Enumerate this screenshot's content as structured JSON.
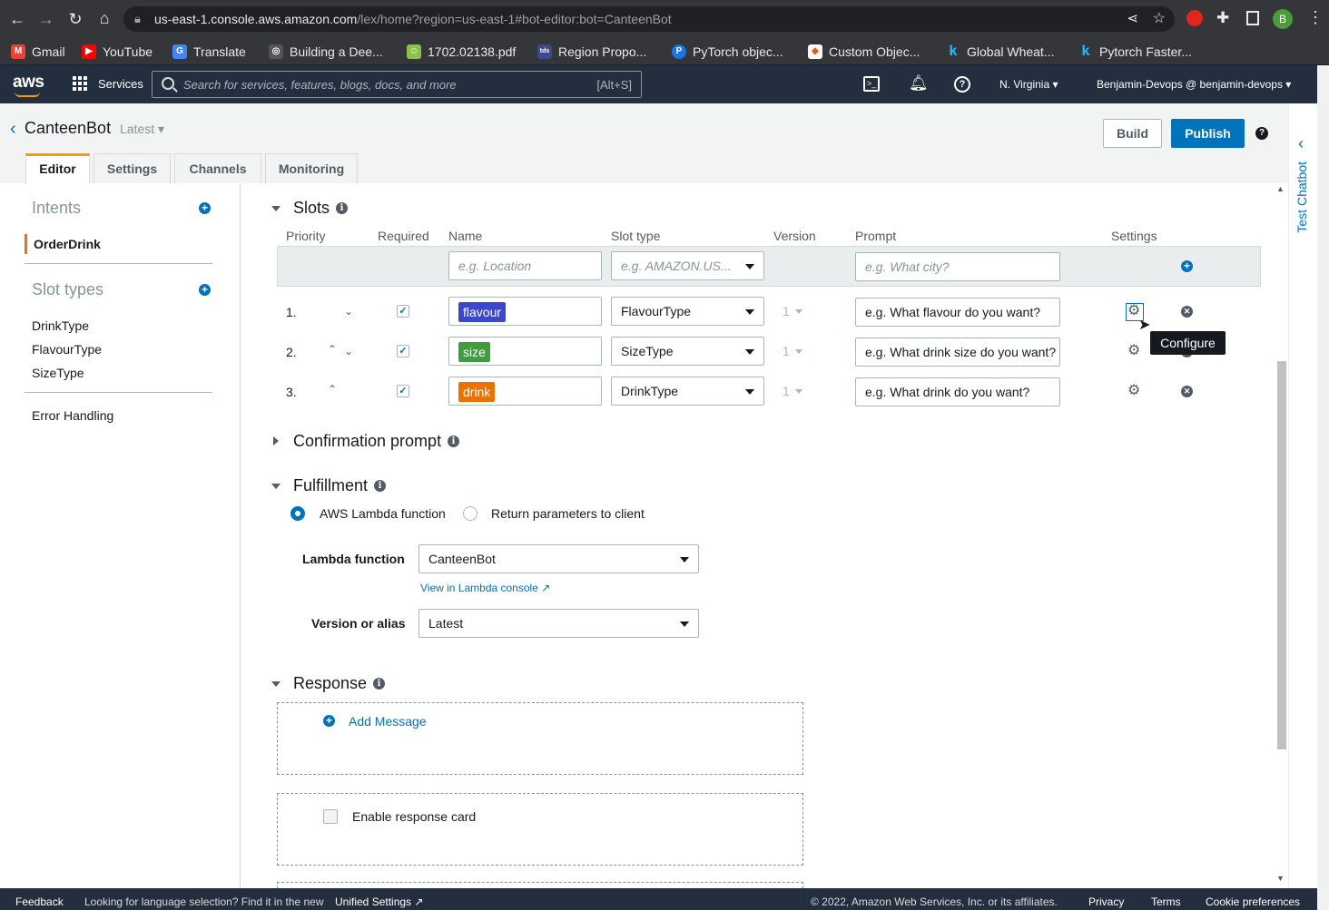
{
  "browser": {
    "url_host": "us-east-1.console.aws.amazon.com",
    "url_path": "/lex/home?region=us-east-1#bot-editor:bot=CanteenBot",
    "profile_initial": "B",
    "bookmarks": [
      "Gmail",
      "YouTube",
      "Translate",
      "Building a Dee...",
      "1702.02138.pdf",
      "Region Propo...",
      "PyTorch objec...",
      "Custom Objec...",
      "Global Wheat...",
      "Pytorch Faster..."
    ]
  },
  "aws_nav": {
    "logo": "aws",
    "services": "Services",
    "search_placeholder": "Search for services, features, blogs, docs, and more",
    "search_shortcut": "[Alt+S]",
    "region": "N. Virginia",
    "account": "Benjamin-Devops @ benjamin-devops"
  },
  "header": {
    "bot_name": "CanteenBot",
    "bot_version": "Latest",
    "build": "Build",
    "publish": "Publish",
    "tabs": [
      "Editor",
      "Settings",
      "Channels",
      "Monitoring"
    ]
  },
  "sidebar": {
    "intents_title": "Intents",
    "intents": [
      "OrderDrink"
    ],
    "slot_types_title": "Slot types",
    "slot_types": [
      "DrinkType",
      "FlavourType",
      "SizeType"
    ],
    "error_handling": "Error Handling"
  },
  "slots": {
    "title": "Slots",
    "columns": [
      "Priority",
      "Required",
      "Name",
      "Slot type",
      "Version",
      "Prompt",
      "Settings"
    ],
    "new_row": {
      "name_placeholder": "e.g. Location",
      "type_placeholder": "e.g. AMAZON.US...",
      "prompt_placeholder": "e.g. What city?"
    },
    "rows": [
      {
        "priority": "1.",
        "name": "flavour",
        "color": "#3b48cc",
        "type": "FlavourType",
        "version": "1",
        "prompt": "e.g. What flavour do you want?"
      },
      {
        "priority": "2.",
        "name": "size",
        "color": "#3f9d3f",
        "type": "SizeType",
        "version": "1",
        "prompt": "e.g. What drink size do you want?"
      },
      {
        "priority": "3.",
        "name": "drink",
        "color": "#eb7100",
        "type": "DrinkType",
        "version": "1",
        "prompt": "e.g. What drink do you want?"
      }
    ],
    "tooltip": "Configure"
  },
  "confirmation": {
    "title": "Confirmation prompt"
  },
  "fulfillment": {
    "title": "Fulfillment",
    "option_lambda": "AWS Lambda function",
    "option_return": "Return parameters to client",
    "lambda_label": "Lambda function",
    "lambda_value": "CanteenBot",
    "lambda_link": "View in Lambda console",
    "version_label": "Version or alias",
    "version_value": "Latest"
  },
  "response": {
    "title": "Response",
    "add_message": "Add Message",
    "enable_card": "Enable response card"
  },
  "right_panel": {
    "test_chatbot": "Test Chatbot"
  },
  "footer": {
    "feedback": "Feedback",
    "language_note": "Looking for language selection? Find it in the new",
    "unified_settings": "Unified Settings",
    "copyright": "© 2022, Amazon Web Services, Inc. or its affiliates.",
    "privacy": "Privacy",
    "terms": "Terms",
    "cookies": "Cookie preferences"
  }
}
